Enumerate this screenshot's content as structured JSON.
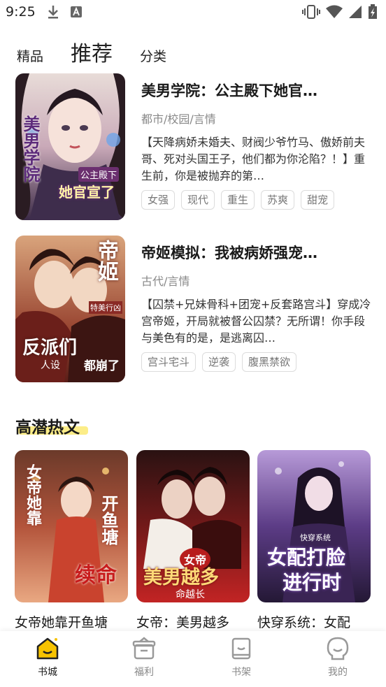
{
  "status_bar": {
    "time": "9:25",
    "left_icons": [
      "download-icon",
      "a-icon"
    ],
    "right_icons": [
      "vibrate-icon",
      "wifi-icon",
      "signal-icon",
      "battery-icon"
    ]
  },
  "top_tabs": [
    {
      "label": "精品",
      "active": false
    },
    {
      "label": "推荐",
      "active": true
    },
    {
      "label": "分类",
      "active": false
    }
  ],
  "books": [
    {
      "title": "美男学院：公主殿下她官…",
      "category": "都市/校园/言情",
      "description": "【天降病娇未婚夫、财阀少爷竹马、傲娇前夫哥、死对头国王子，他们都为你沦陷？！】重生前，你是被抛弃的第…",
      "tags": [
        "女强",
        "现代",
        "重生",
        "苏爽",
        "甜宠"
      ],
      "cover_text": [
        "美男学院",
        "公主殿下",
        "她官宣了"
      ]
    },
    {
      "title": "帝姬模拟：我被病娇强宠…",
      "category": "古代/言情",
      "description": "【囚禁+兄妹骨科+团宠+反套路宫斗】穿成冷宫帝姬，开局就被督公囚禁？无所谓！你手段与美色有的是，是逃离囚…",
      "tags": [
        "宫斗宅斗",
        "逆袭",
        "腹黑禁欲"
      ],
      "cover_text": [
        "帝姬",
        "特美行凶",
        "反派们",
        "人设",
        "都崩了"
      ]
    }
  ],
  "section": {
    "title": "高潜热文"
  },
  "grid_books": [
    {
      "title": "女帝她靠开鱼塘",
      "cover_text": [
        "女帝她靠",
        "开鱼塘",
        "续命"
      ]
    },
    {
      "title": "女帝：美男越多",
      "cover_text": [
        "女帝",
        "美男越多",
        "命越长"
      ]
    },
    {
      "title": "快穿系统：女配",
      "cover_text": [
        "快穿系统",
        "女配打脸",
        "进行时"
      ]
    }
  ],
  "bottom_nav": [
    {
      "label": "书城",
      "icon": "bookstore-house-icon",
      "active": true
    },
    {
      "label": "福利",
      "icon": "gift-icon",
      "active": false
    },
    {
      "label": "书架",
      "icon": "bookshelf-icon",
      "active": false
    },
    {
      "label": "我的",
      "icon": "profile-face-icon",
      "active": false
    }
  ],
  "colors": {
    "accent": "#f7c300",
    "highlight": "#fbe96a",
    "muted": "#888888"
  }
}
